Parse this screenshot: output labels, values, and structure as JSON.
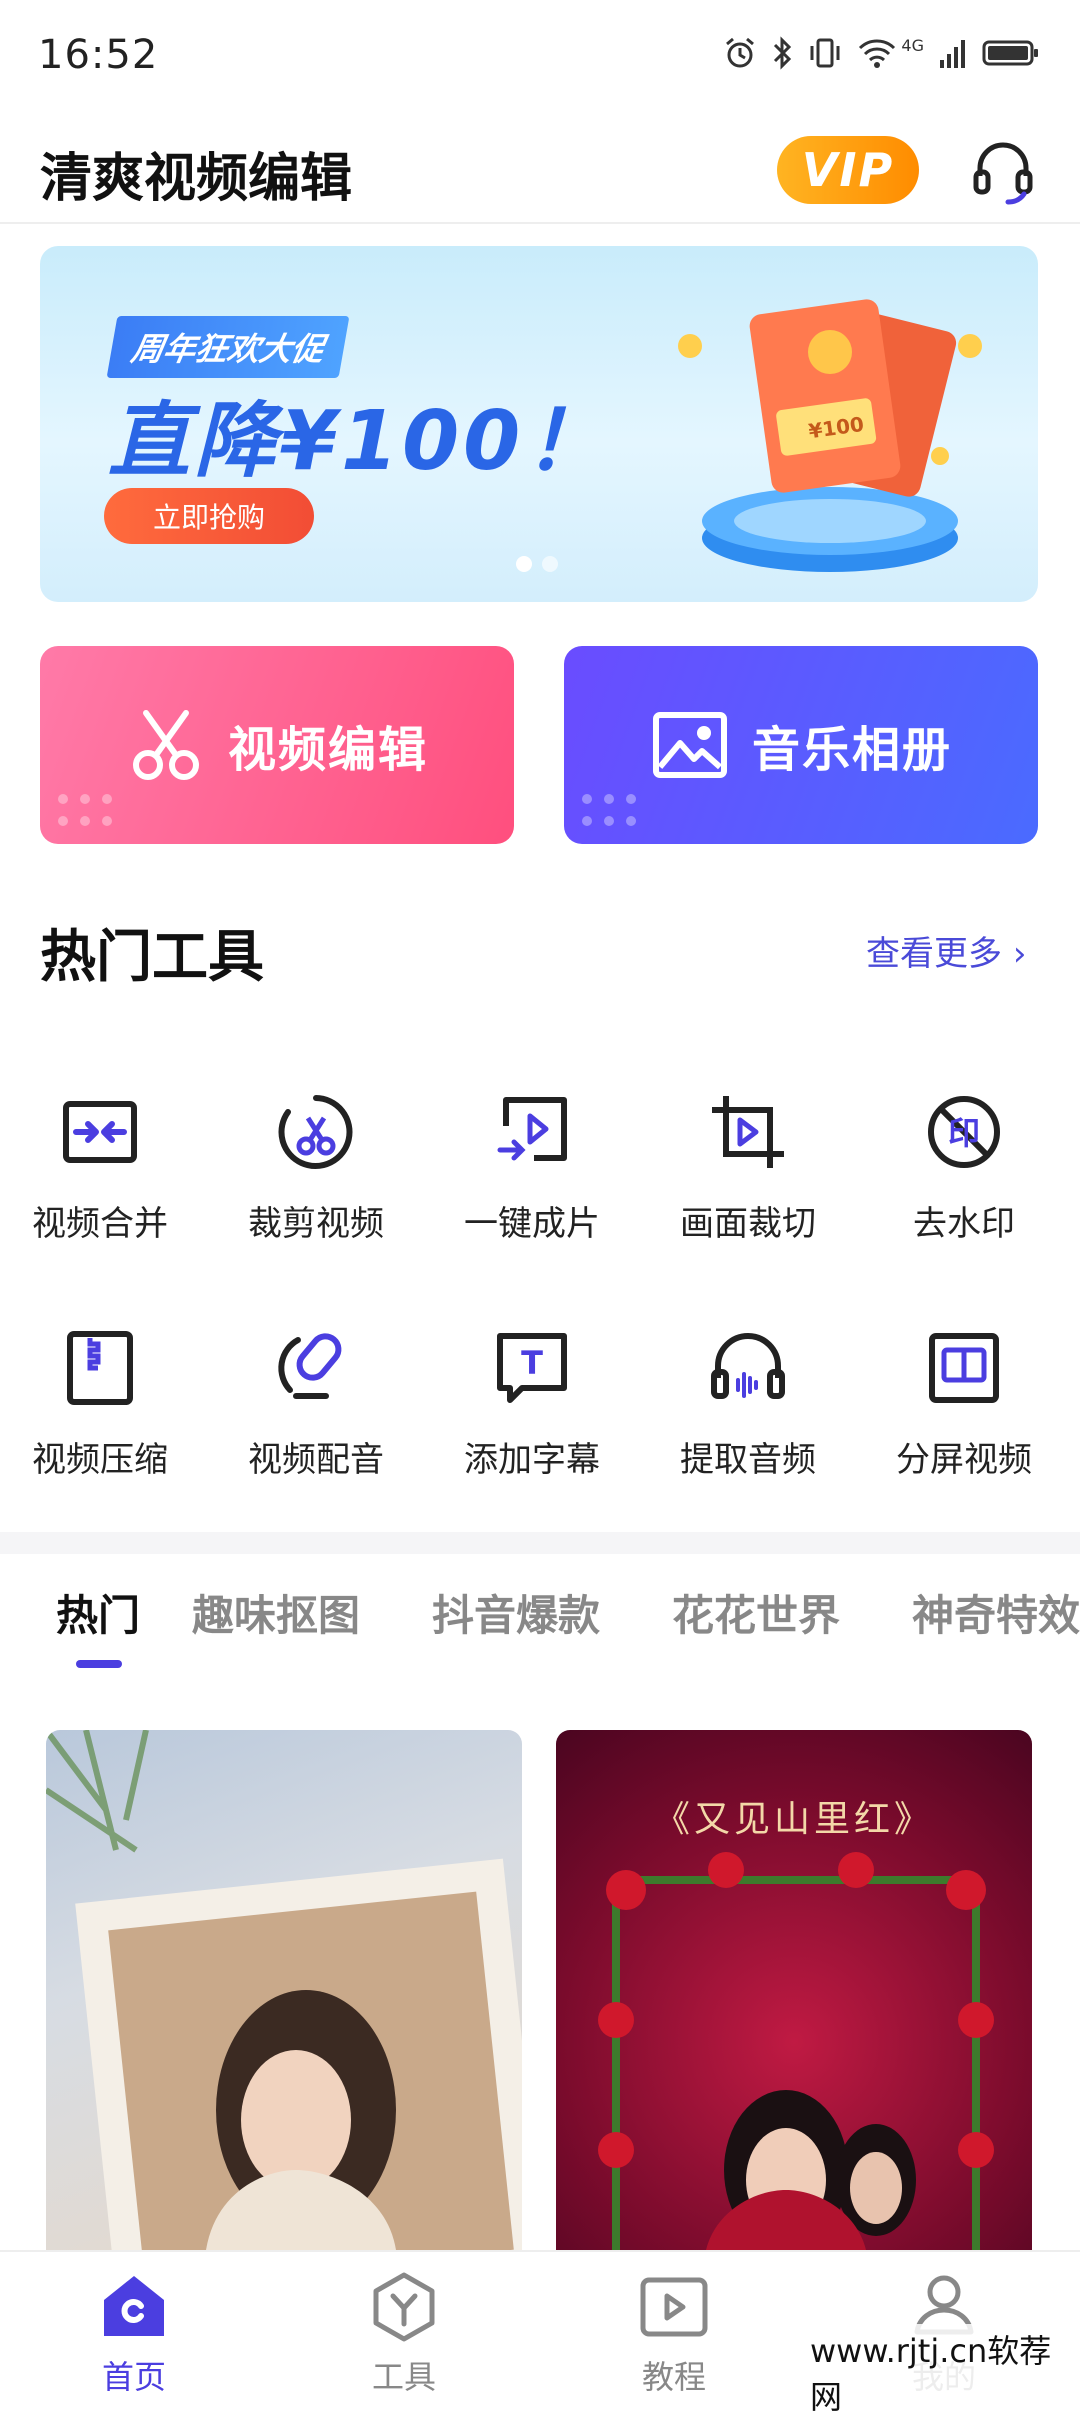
{
  "status_bar": {
    "time": "16:52",
    "network": "4G"
  },
  "header": {
    "title": "清爽视频编辑",
    "vip_label": "VIP"
  },
  "banner": {
    "tag": "周年狂欢大促",
    "headline": "直降¥100！",
    "button": "立即抢购",
    "coupon_text": "¥100",
    "slides_count": 2,
    "active_slide": 1
  },
  "feature_cards": [
    {
      "label": "视频编辑",
      "icon": "scissors-icon"
    },
    {
      "label": "音乐相册",
      "icon": "image-icon"
    }
  ],
  "hot_tools": {
    "title": "热门工具",
    "see_more": "查看更多",
    "items": [
      {
        "label": "视频合并",
        "icon": "merge-icon"
      },
      {
        "label": "裁剪视频",
        "icon": "cut-video-icon"
      },
      {
        "label": "一键成片",
        "icon": "one-click-icon"
      },
      {
        "label": "画面裁切",
        "icon": "crop-icon"
      },
      {
        "label": "去水印",
        "icon": "remove-watermark-icon",
        "glyph": "印"
      },
      {
        "label": "视频压缩",
        "icon": "compress-icon"
      },
      {
        "label": "视频配音",
        "icon": "dubbing-icon"
      },
      {
        "label": "添加字幕",
        "icon": "subtitle-icon",
        "glyph": "T"
      },
      {
        "label": "提取音频",
        "icon": "extract-audio-icon"
      },
      {
        "label": "分屏视频",
        "icon": "split-screen-icon"
      }
    ]
  },
  "category_tabs": [
    {
      "label": "热门",
      "active": true
    },
    {
      "label": "趣味抠图",
      "active": false
    },
    {
      "label": "抖音爆款",
      "active": false
    },
    {
      "label": "花花世界",
      "active": false
    },
    {
      "label": "神奇特效",
      "active": false
    }
  ],
  "templates": [
    {
      "title": "",
      "image": "portrait-photo"
    },
    {
      "title": "《又见山里红》",
      "image": "rose-frame-photo"
    }
  ],
  "bottom_nav": [
    {
      "label": "首页",
      "icon": "home-icon",
      "active": true
    },
    {
      "label": "工具",
      "icon": "tools-icon",
      "active": false
    },
    {
      "label": "教程",
      "icon": "tutorial-icon",
      "active": false
    },
    {
      "label": "我的",
      "icon": "profile-icon",
      "active": false
    }
  ],
  "watermark": "www.rjtj.cn软荐网",
  "colors": {
    "accent": "#4b3ee0",
    "vip": "#ff9a12",
    "banner_blue": "#2a66e6"
  }
}
